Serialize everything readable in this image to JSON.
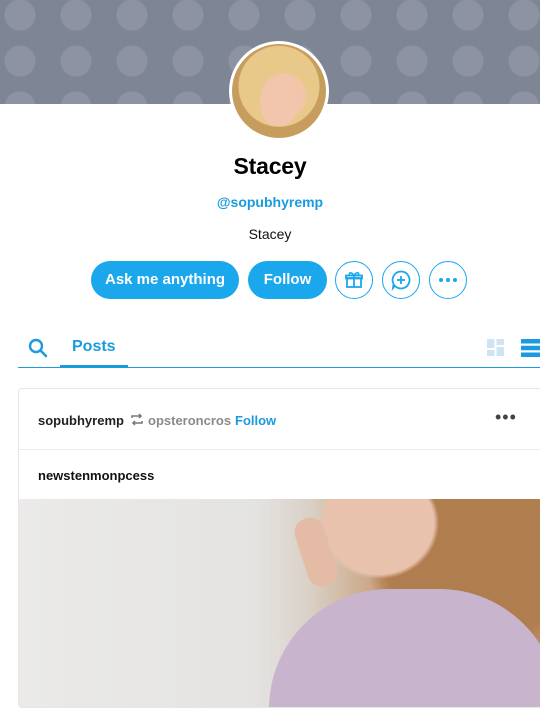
{
  "profile": {
    "name": "Stacey",
    "handle": "@sopubhyremp",
    "description": "Stacey"
  },
  "actions": {
    "ask_label": "Ask me anything",
    "follow_label": "Follow",
    "gift_icon": "gift-icon",
    "message_icon": "chat-plus-icon",
    "more_icon": "more-icon"
  },
  "tabs": {
    "posts_label": "Posts",
    "view_modes": [
      "grid-view-icon",
      "list-view-icon"
    ]
  },
  "post": {
    "author": "sopubhyremp",
    "reblogged_from": "opsteroncros",
    "follow_label": "Follow",
    "more_label": "•••",
    "title": "newstenmonpcess"
  },
  "colors": {
    "accent": "#1aa7ec",
    "link": "#1a9be0",
    "banner": "#7e8595"
  }
}
